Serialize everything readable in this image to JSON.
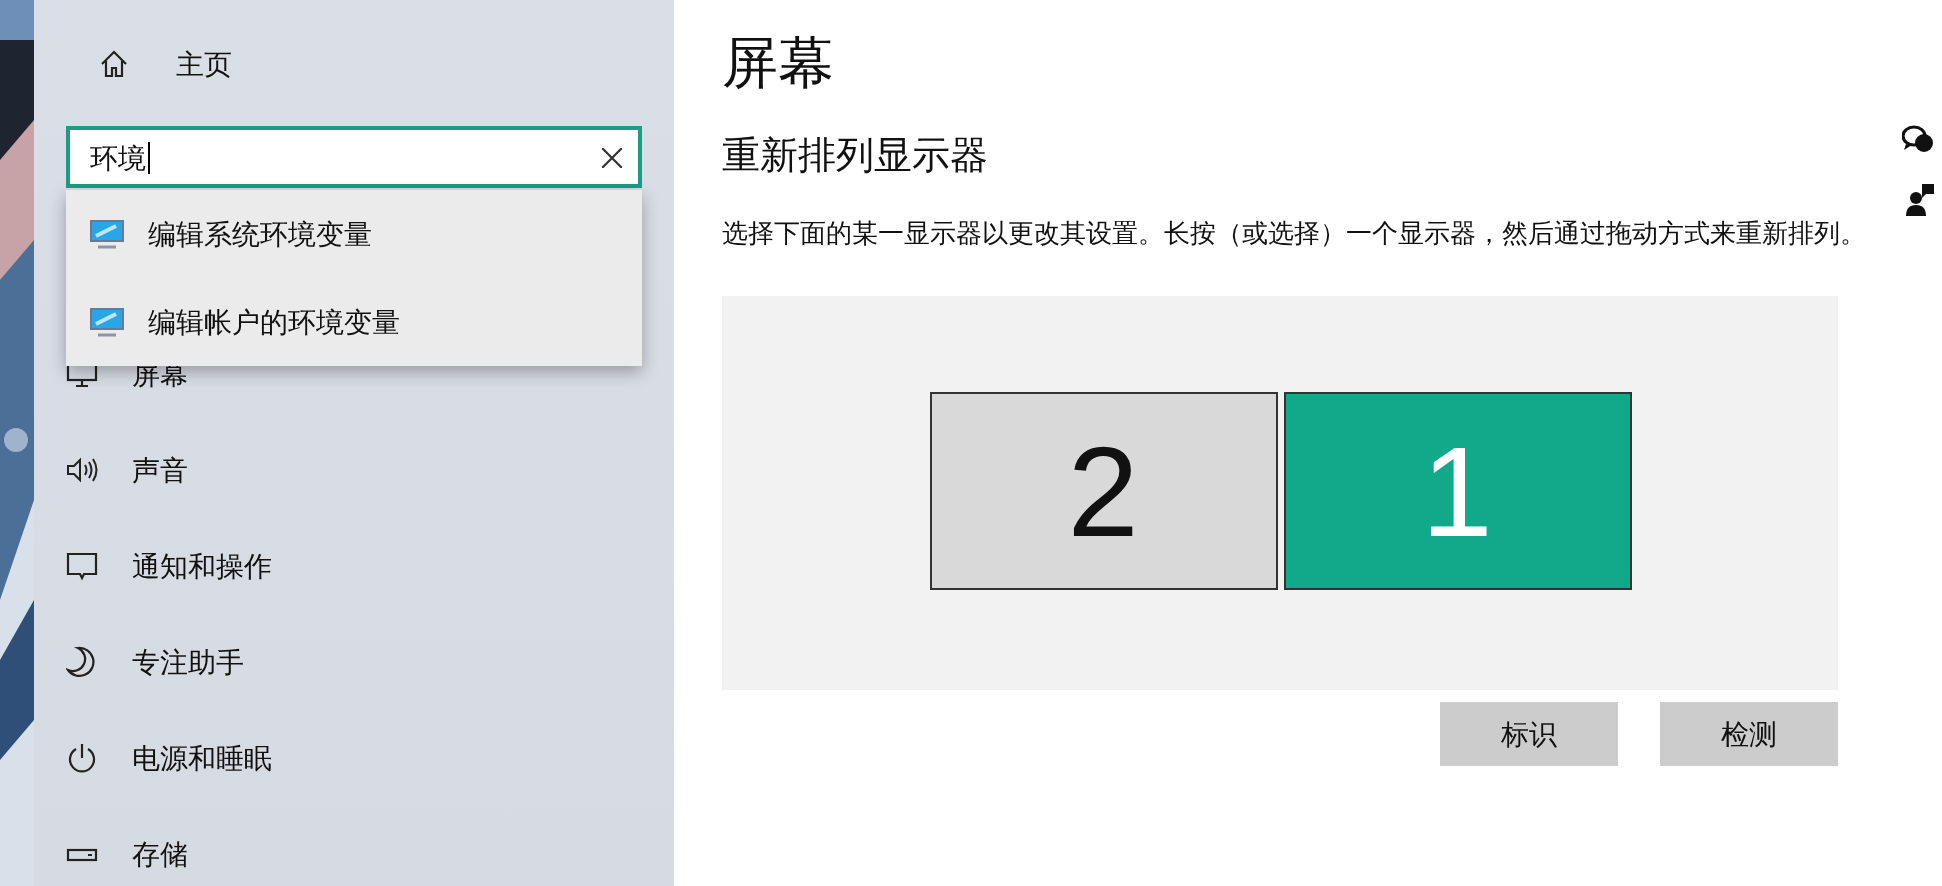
{
  "sidebar": {
    "home": "主页",
    "search": {
      "value": "环境",
      "suggestions": [
        {
          "label": "编辑系统环境变量"
        },
        {
          "label": "编辑帐户的环境变量"
        }
      ]
    },
    "items": [
      {
        "label": "屏幕",
        "kind": "display"
      },
      {
        "label": "声音",
        "kind": "sound"
      },
      {
        "label": "通知和操作",
        "kind": "notify"
      },
      {
        "label": "专注助手",
        "kind": "moon"
      },
      {
        "label": "电源和睡眠",
        "kind": "power"
      },
      {
        "label": "存储",
        "kind": "storage"
      }
    ]
  },
  "page": {
    "title": "屏幕",
    "heading": "重新排列显示器",
    "description": "选择下面的某一显示器以更改其设置。长按（或选择）一个显示器，然后通过拖动方式来重新排列。",
    "monitors": [
      {
        "label": "2",
        "selected": false
      },
      {
        "label": "1",
        "selected": true
      }
    ],
    "buttons": [
      "标识",
      "检测"
    ]
  }
}
